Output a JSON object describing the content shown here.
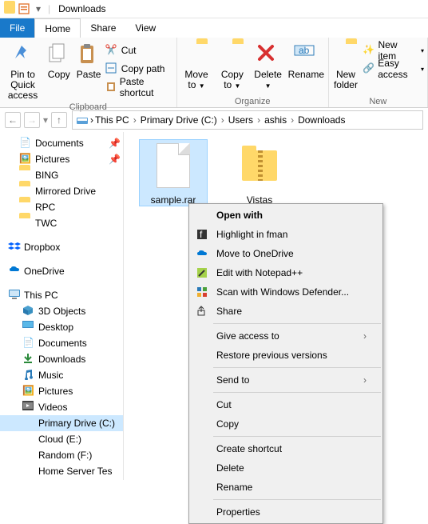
{
  "title": "Downloads",
  "tabs": {
    "file": "File",
    "home": "Home",
    "share": "Share",
    "view": "View"
  },
  "ribbon": {
    "clipboard": {
      "pin": "Pin to Quick access",
      "copy": "Copy",
      "paste": "Paste",
      "cut": "Cut",
      "copypath": "Copy path",
      "pasteshortcut": "Paste shortcut",
      "label": "Clipboard"
    },
    "organize": {
      "moveto": "Move to",
      "copyto": "Copy to",
      "delete": "Delete",
      "rename": "Rename",
      "label": "Organize"
    },
    "new": {
      "newfolder": "New folder",
      "newitem": "New item",
      "easyaccess": "Easy access",
      "label": "New"
    }
  },
  "breadcrumb": [
    "This PC",
    "Primary Drive (C:)",
    "Users",
    "ashis",
    "Downloads"
  ],
  "tree": {
    "documents": "Documents",
    "pictures": "Pictures",
    "bing": "BING",
    "mirrored": "Mirrored Drive",
    "rpc": "RPC",
    "twc": "TWC",
    "dropbox": "Dropbox",
    "onedrive": "OneDrive",
    "thispc": "This PC",
    "objects3d": "3D Objects",
    "desktop": "Desktop",
    "documents2": "Documents",
    "downloads": "Downloads",
    "music": "Music",
    "pictures2": "Pictures",
    "videos": "Videos",
    "primary": "Primary Drive (C:)",
    "cloud": "Cloud (E:)",
    "random": "Random (F:)",
    "homeserver": "Home Server Tes"
  },
  "files": {
    "sample": "sample.rar",
    "vistas": "Vistas"
  },
  "menu": {
    "openwith": "Open with",
    "highlight": "Highlight in fman",
    "onedrive": "Move to OneDrive",
    "notepad": "Edit with Notepad++",
    "defender": "Scan with Windows Defender...",
    "share": "Share",
    "giveaccess": "Give access to",
    "restore": "Restore previous versions",
    "sendto": "Send to",
    "cut": "Cut",
    "copy": "Copy",
    "shortcut": "Create shortcut",
    "delete": "Delete",
    "rename": "Rename",
    "properties": "Properties"
  }
}
